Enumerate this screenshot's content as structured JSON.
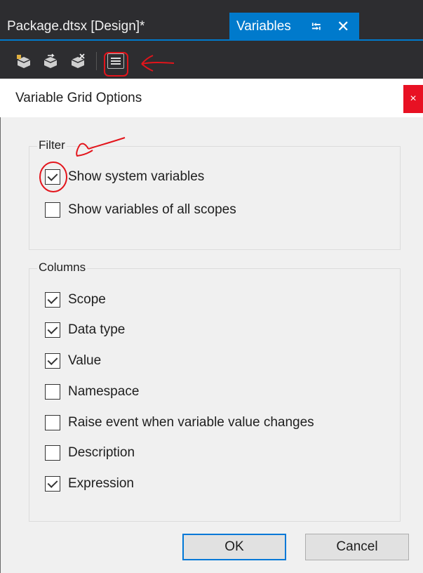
{
  "tabs": [
    {
      "label": "Package.dtsx [Design]*",
      "active": false
    },
    {
      "label": "Variables",
      "active": true,
      "pin_glyph": "⭾",
      "close_glyph": "✕"
    }
  ],
  "toolbar": {
    "icons": [
      "add-variable-icon",
      "move-variable-icon",
      "delete-variable-icon",
      "grid-options-icon"
    ]
  },
  "dialog": {
    "title": "Variable Grid Options",
    "close_glyph": "×",
    "filter": {
      "legend": "Filter",
      "options": [
        {
          "label": "Show system variables",
          "checked": true
        },
        {
          "label": "Show variables of all scopes",
          "checked": false
        }
      ]
    },
    "columns": {
      "legend": "Columns",
      "options": [
        {
          "label": "Scope",
          "checked": true
        },
        {
          "label": "Data type",
          "checked": true
        },
        {
          "label": "Value",
          "checked": true
        },
        {
          "label": "Namespace",
          "checked": false
        },
        {
          "label": "Raise event when variable value changes",
          "checked": false
        },
        {
          "label": "Description",
          "checked": false
        },
        {
          "label": "Expression",
          "checked": true
        }
      ]
    },
    "ok_label": "OK",
    "cancel_label": "Cancel"
  },
  "colors": {
    "accent": "#007acc",
    "dark_bg": "#2d2d30",
    "annotation": "#e3141b",
    "close_red": "#e81123"
  }
}
